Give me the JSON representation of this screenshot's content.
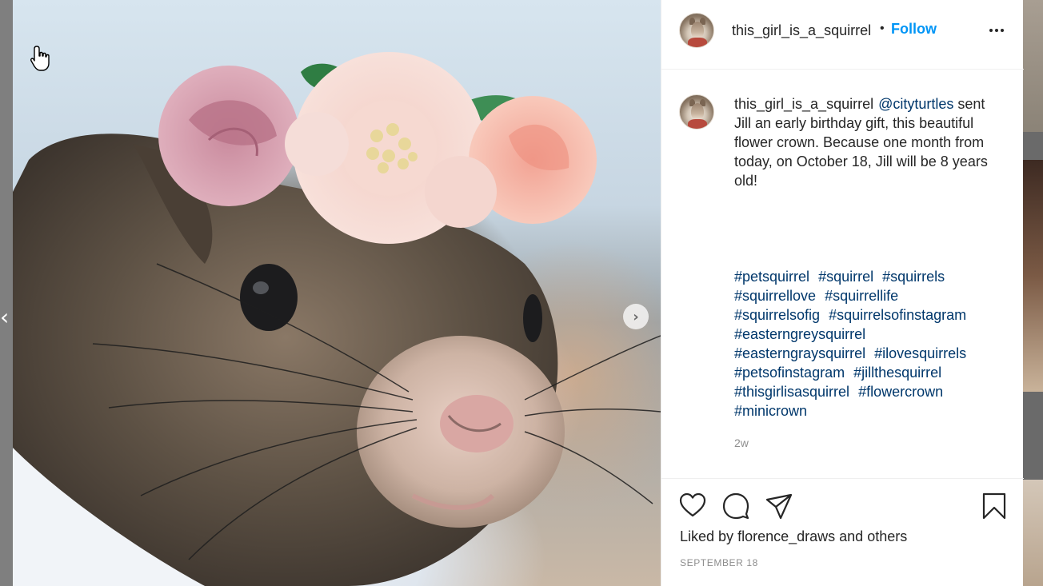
{
  "post": {
    "username": "this_girl_is_a_squirrel",
    "separator": "•",
    "follow_label": "Follow",
    "caption": {
      "username": "this_girl_is_a_squirrel",
      "mention": "@cityturtles",
      "text": "sent Jill an early birthday gift, this beautiful flower crown. Because one month from today, on October 18, Jill will be 8 years old!"
    },
    "hashtags": [
      "#petsquirrel",
      "#squirrel",
      "#squirrels",
      "#squirrellove",
      "#squirrellife",
      "#squirrelsofig",
      "#squirrelsofinstagram",
      "#easterngreysquirrel",
      "#easterngraysquirrel",
      "#ilovesquirrels",
      "#petsofinstagram",
      "#jillthesquirrel",
      "#thisgirlisasquirrel",
      "#flowercrown",
      "#minicrown"
    ],
    "time_ago": "2w",
    "likes": {
      "prefix": "Liked by",
      "user": "florence_draws",
      "conjunction": "and",
      "others": "others"
    },
    "date": "SEPTEMBER 18"
  },
  "icons": {
    "more": "more-options-icon",
    "like": "heart-icon",
    "comment": "comment-bubble-icon",
    "share": "paper-plane-icon",
    "save": "bookmark-icon",
    "prev": "chevron-left-icon",
    "next": "chevron-right-icon"
  },
  "colors": {
    "follow_blue": "#0095f6",
    "link_navy": "#00376b",
    "muted_grey": "#8e8e8e",
    "text": "#262626"
  }
}
